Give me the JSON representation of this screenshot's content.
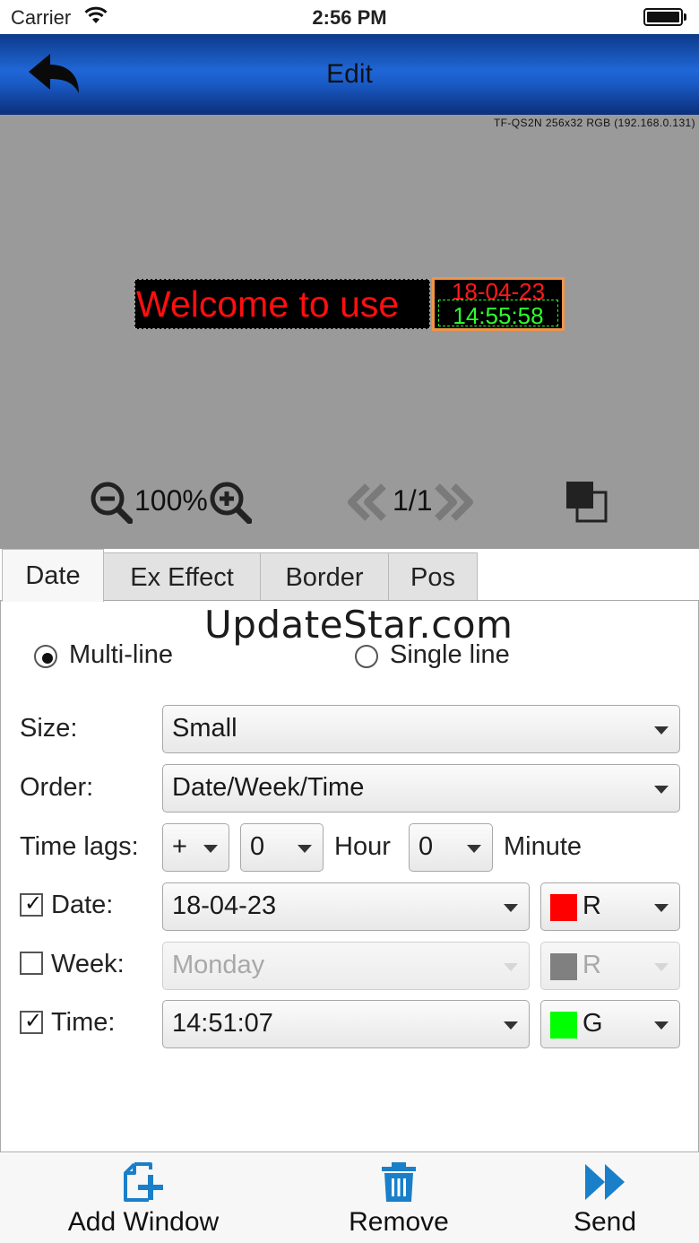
{
  "status": {
    "carrier": "Carrier",
    "time": "2:56 PM"
  },
  "nav": {
    "title": "Edit"
  },
  "canvas": {
    "device_info": "TF-QS2N 256x32 RGB (192.168.0.131)",
    "led_text": "Welcome to use",
    "led_date": "18-04-23",
    "led_time": "14:55:58",
    "zoom": "100%",
    "page": "1/1"
  },
  "tabs": [
    "Date",
    "Ex Effect",
    "Border",
    "Pos"
  ],
  "watermark": "UpdateStar.com",
  "form": {
    "multiline_label": "Multi-line",
    "singleline_label": "Single line",
    "size_label": "Size:",
    "size_value": "Small",
    "order_label": "Order:",
    "order_value": "Date/Week/Time",
    "timelags_label": "Time lags:",
    "sign_value": "+",
    "hour_value": "0",
    "hour_label": "Hour",
    "minute_value": "0",
    "minute_label": "Minute",
    "date_label": "Date:",
    "date_value": "18-04-23",
    "date_color": "R",
    "week_label": "Week:",
    "week_value": "Monday",
    "week_color": "R",
    "time_label": "Time:",
    "time_value": "14:51:07",
    "time_color": "G"
  },
  "colors": {
    "red": "#ff0000",
    "grey": "#808080",
    "green": "#00ff00",
    "accent": "#1a7fc9"
  },
  "toolbar": {
    "add": "Add Window",
    "remove": "Remove",
    "send": "Send"
  }
}
